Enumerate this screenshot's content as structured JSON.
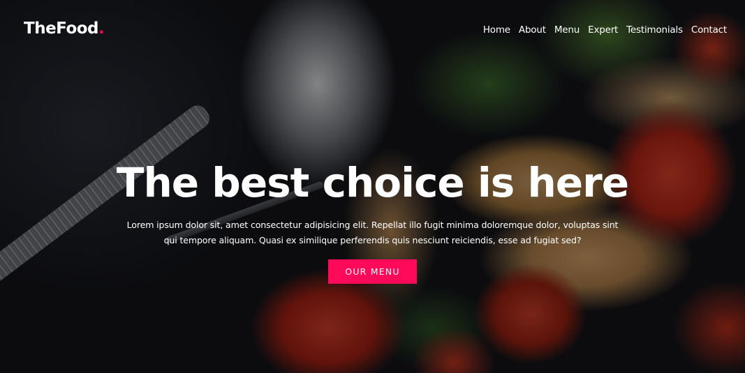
{
  "brand": {
    "name": "TheFood",
    "dot": ".",
    "accent_color": "#ff0055"
  },
  "nav": {
    "items": [
      {
        "label": "Home"
      },
      {
        "label": "About"
      },
      {
        "label": "Menu"
      },
      {
        "label": "Expert"
      },
      {
        "label": "Testimonials"
      },
      {
        "label": "Contact"
      }
    ]
  },
  "hero": {
    "title": "The best choice is here",
    "description": "Lorem ipsum dolor sit, amet consectetur adipisicing elit. Repellat illo fugit minima doloremque dolor, voluptas sint qui tempore aliquam. Quasi ex similique perferendis quis nesciunt reiciendis, esse ad fugiat sed?",
    "button_label": "OUR MENU",
    "button_color": "#ff0a5a",
    "background_image": "blurred-pasta-food-photo"
  }
}
